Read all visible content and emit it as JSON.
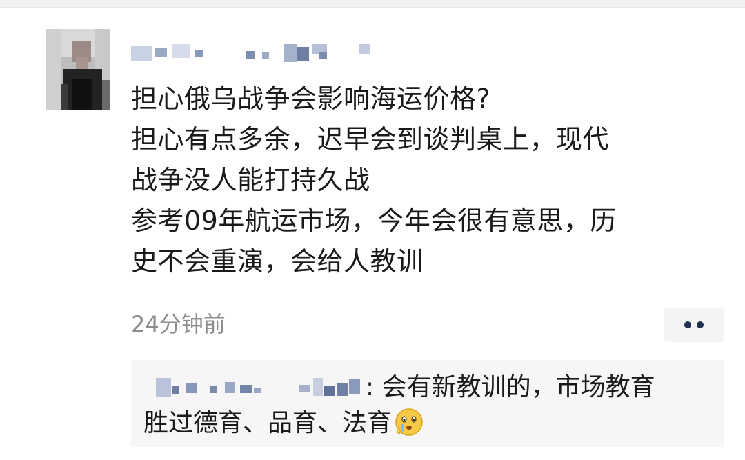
{
  "post": {
    "text_lines": [
      "担心俄乌战争会影响海运价格?",
      "担心有点多余，迟早会到谈判桌上，现代",
      "战争没人能打持久战",
      "参考09年航运市场，今年会很有意思，历",
      "史不会重演，会给人教训"
    ],
    "timestamp": "24分钟前"
  },
  "reply": {
    "separator": ":",
    "text_line1": " 会有新教训的，市场教育",
    "text_line2": "胜过德育、品育、法育"
  },
  "icons": {
    "more": "more-dots-icon",
    "emoji": "crying-face-emoji-icon"
  },
  "colors": {
    "text": "#1a1a1a",
    "timestamp": "#8c8c8c",
    "reply_background": "#f6f6f6",
    "more_dots": "#1f3050"
  }
}
